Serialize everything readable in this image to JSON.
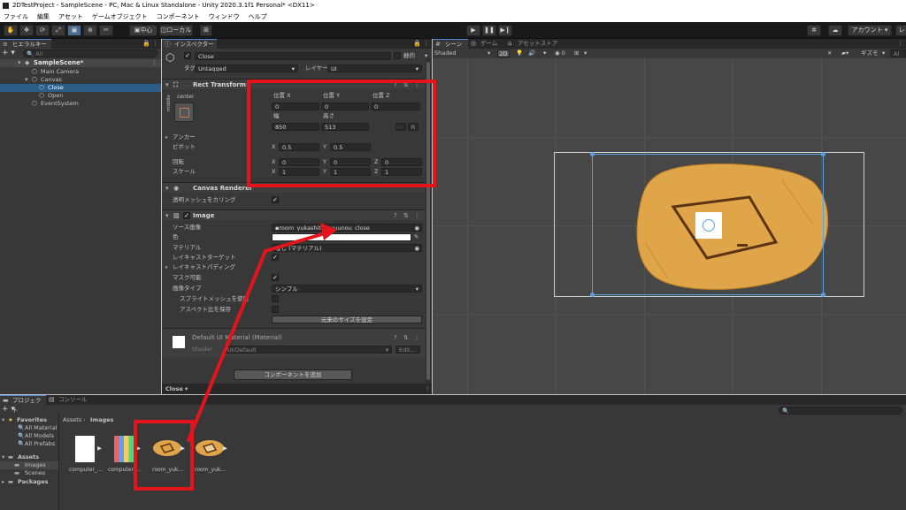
{
  "window": {
    "title": "2DTestProject - SampleScene - PC, Mac & Linux Standalone - Unity 2020.3.1f1 Personal* <DX11>"
  },
  "menu": [
    "ファイル",
    "編集",
    "アセット",
    "ゲームオブジェクト",
    "コンポーネント",
    "ウィンドウ",
    "ヘルプ"
  ],
  "toolbar": {
    "pivot_label": "中心",
    "space_label": "ローカル",
    "account_label": "アカウント"
  },
  "hierarchy": {
    "tab": "ヒエラルキー",
    "search_placeholder": "All",
    "items": [
      {
        "label": "SampleScene*",
        "depth": 0
      },
      {
        "label": "Main Camera",
        "depth": 1
      },
      {
        "label": "Canvas",
        "depth": 1
      },
      {
        "label": "Close",
        "depth": 2,
        "selected": true
      },
      {
        "label": "Open",
        "depth": 2
      },
      {
        "label": "EventSystem",
        "depth": 1
      }
    ]
  },
  "inspector": {
    "tab": "インスペクター",
    "object_name": "Close",
    "static_label": "静的",
    "tag_label": "タグ",
    "tag_value": "Untagged",
    "layer_label": "レイヤー",
    "layer_value": "UI",
    "rect_transform": {
      "title": "Rect Transform",
      "anchor_h": "center",
      "anchor_v": "middle",
      "pos_x_label": "位置 X",
      "pos_y_label": "位置 Y",
      "pos_z_label": "位置 Z",
      "pos_x": "0",
      "pos_y": "0",
      "pos_z": "0",
      "width_label": "幅",
      "height_label": "高さ",
      "width": "850",
      "height": "513",
      "r_label": "R",
      "anchor_label": "アンカー",
      "pivot_label": "ピボット",
      "pivot_x": "0.5",
      "pivot_y": "0.5",
      "rotation_label": "回転",
      "rot_x": "0",
      "rot_y": "0",
      "rot_z": "0",
      "scale_label": "スケール",
      "scale_x": "1",
      "scale_y": "1",
      "scale_z": "1"
    },
    "canvas_renderer": {
      "title": "Canvas Renderer",
      "cull_label": "透明メッシュをカリング"
    },
    "image": {
      "title": "Image",
      "source_label": "ソース画像",
      "source_value": "room_yukashita_syuunou_close",
      "color_label": "色",
      "material_label": "マテリアル",
      "material_value": "なし (マテリアル)",
      "raycast_target_label": "レイキャストターゲット",
      "raycast_padding_label": "レイキャストパディング",
      "maskable_label": "マスク可能",
      "image_type_label": "画像タイプ",
      "image_type_value": "シンプル",
      "use_sprite_mesh_label": "スプライトメッシュを使用",
      "preserve_aspect_label": "アスペクト比を保存",
      "set_native_size": "元来のサイズを設定"
    },
    "material": {
      "name": "Default UI Material (Material)",
      "shader_label": "Shader",
      "shader_value": "UI/Default",
      "edit_label": "Edit..."
    },
    "add_component": "コンポーネントを追加",
    "footer_label": "Close"
  },
  "scene": {
    "tabs": [
      "シーン",
      "ゲーム",
      "アセットストア"
    ],
    "shading": "Shaded",
    "mode_2d": "2D",
    "gizmos": "ギズモ"
  },
  "project": {
    "tabs": [
      "プロジェクト",
      "コンソール"
    ],
    "favorites_label": "Favorites",
    "favorites": [
      "All Material",
      "All Models",
      "All Prefabs"
    ],
    "assets_label": "Assets",
    "asset_folders": [
      "Images",
      "Scenes"
    ],
    "packages_label": "Packages",
    "breadcrumb_root": "Assets",
    "breadcrumb_current": "Images",
    "files": [
      "computer_...",
      "computer_...",
      "room_yuk...",
      "room_yuk..."
    ]
  },
  "colors": {
    "accent_blue": "#5a8ad6",
    "highlight_red": "#e4141c",
    "floor_orange": "#e0a548"
  }
}
